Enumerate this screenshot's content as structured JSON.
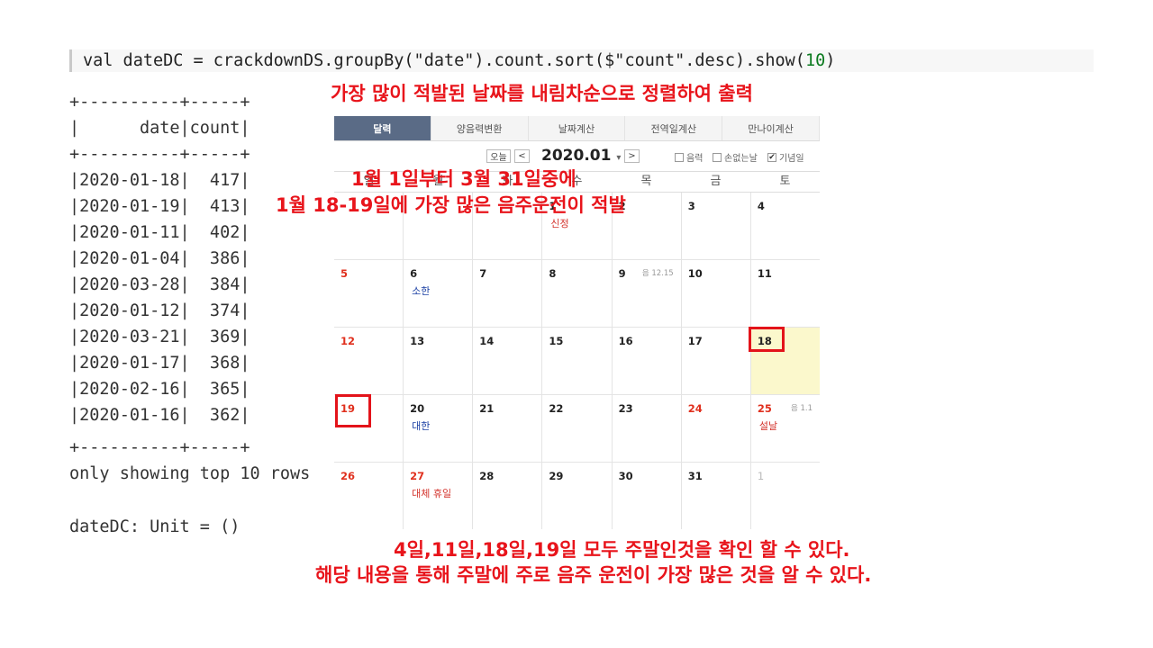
{
  "code": {
    "prefix": "val dateDC = crackdownDS.groupBy(\"date\").count.sort($\"count\".desc).show(",
    "arg": "10",
    "suffix": ")"
  },
  "notes": {
    "top": "가장 많이 적발된 날짜를 내림차순으로 정렬하여 출력",
    "mid1": "1월 1일부터 3월 31일중에",
    "mid2": "1월 18-19일에 가장 많은 음주운전이 적발",
    "bottom1": "4일,11일,18일,19일 모두 주말인것을 확인 할 수 있다.",
    "bottom2": "해당 내용을 통해 주말에 주로 음주 운전이 가장 많은 것을 알 수 있다."
  },
  "output": {
    "border": "+----------+-----+",
    "header": "|      date|count|",
    "rows": [
      "|2020-01-18|  417|",
      "|2020-01-19|  413|",
      "|2020-01-11|  402|",
      "|2020-01-04|  386|",
      "|2020-03-28|  384|",
      "|2020-01-12|  374|",
      "|2020-03-21|  369|",
      "|2020-01-17|  368|",
      "|2020-02-16|  365|",
      "|2020-01-16|  362|"
    ],
    "footer": "only showing top 10 rows",
    "result": "dateDC: Unit = ()"
  },
  "calendar": {
    "tabs": [
      "달력",
      "양음력변환",
      "날짜계산",
      "전역일계산",
      "만나이계산"
    ],
    "today_btn": "오늘",
    "prev": "<",
    "next": ">",
    "month": "2020.01",
    "month_caret": "▾",
    "options": [
      {
        "label": "음력",
        "checked": false
      },
      {
        "label": "손없는날",
        "checked": false
      },
      {
        "label": "기념일",
        "checked": true
      }
    ],
    "weekdays": [
      "일",
      "월",
      "화",
      "수",
      "목",
      "금",
      "토"
    ],
    "weeks": [
      [
        {
          "d": ""
        },
        {
          "d": ""
        },
        {
          "d": ""
        },
        {
          "d": "1",
          "event": "신정",
          "ec": "redt"
        },
        {
          "d": "2"
        },
        {
          "d": "3"
        },
        {
          "d": "4"
        }
      ],
      [
        {
          "d": "5",
          "red": true
        },
        {
          "d": "6",
          "event": "소한",
          "ec": "blue"
        },
        {
          "d": "7"
        },
        {
          "d": "8"
        },
        {
          "d": "9",
          "lunar": "음 12.15"
        },
        {
          "d": "10"
        },
        {
          "d": "11"
        }
      ],
      [
        {
          "d": "12",
          "red": true
        },
        {
          "d": "13"
        },
        {
          "d": "14"
        },
        {
          "d": "15"
        },
        {
          "d": "16"
        },
        {
          "d": "17"
        },
        {
          "d": "18",
          "today": true
        }
      ],
      [
        {
          "d": "19",
          "red": true
        },
        {
          "d": "20",
          "event": "대한",
          "ec": "blue"
        },
        {
          "d": "21"
        },
        {
          "d": "22"
        },
        {
          "d": "23"
        },
        {
          "d": "24",
          "red": true
        },
        {
          "d": "25",
          "red": true,
          "lunar": "음 1.1",
          "event": "설날",
          "ec": "redt"
        }
      ],
      [
        {
          "d": "26",
          "red": true
        },
        {
          "d": "27",
          "red": true,
          "event": "대체 휴일",
          "ec": "redt"
        },
        {
          "d": "28"
        },
        {
          "d": "29"
        },
        {
          "d": "30"
        },
        {
          "d": "31"
        },
        {
          "d": "1",
          "faint": true
        }
      ]
    ]
  },
  "colors": {
    "accent_red": "#e8141b",
    "tab_active": "#5a6b86"
  }
}
